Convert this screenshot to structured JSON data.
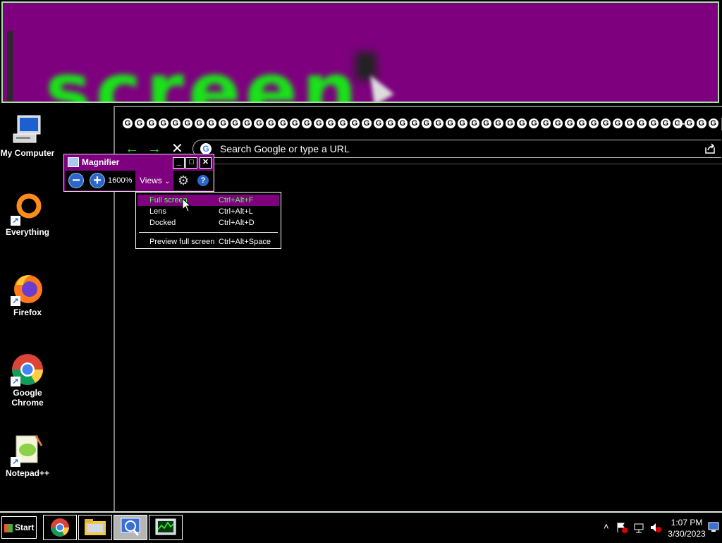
{
  "magnifier_pane": {
    "magnified_text": "screen"
  },
  "desktop": {
    "icons": [
      {
        "label": "My Computer"
      },
      {
        "label": "Everything"
      },
      {
        "label": "Firefox"
      },
      {
        "label": "Google Chrome"
      },
      {
        "label": "Notepad++"
      }
    ]
  },
  "chrome": {
    "tab_glyph": "G",
    "tab_count": 50,
    "new_tab_label": "+",
    "omnibox_placeholder": "Search Google or type a URL",
    "google_badge": "G"
  },
  "magnifier_window": {
    "title": "Magnifier",
    "zoom_level": "1600%",
    "views_label": "Views",
    "minimize": "_",
    "maximize": "□",
    "close": "✕",
    "zoom_out": "−",
    "zoom_in": "+",
    "help": "?"
  },
  "views_menu": {
    "items": [
      {
        "label": "Full screen",
        "shortcut": "Ctrl+Alt+F",
        "selected": true
      },
      {
        "label": "Lens",
        "shortcut": "Ctrl+Alt+L",
        "selected": false
      },
      {
        "label": "Docked",
        "shortcut": "Ctrl+Alt+D",
        "selected": false
      }
    ],
    "preview": {
      "label": "Preview full screen",
      "shortcut": "Ctrl+Alt+Space"
    }
  },
  "taskbar": {
    "start_label": "Start",
    "time": "1:07 PM",
    "date": "3/30/2023"
  },
  "colors": {
    "accent": "#7e007e",
    "highlight_text": "#5fff5f",
    "magnified_text": "#19e319",
    "border_green": "#9fe39f"
  }
}
